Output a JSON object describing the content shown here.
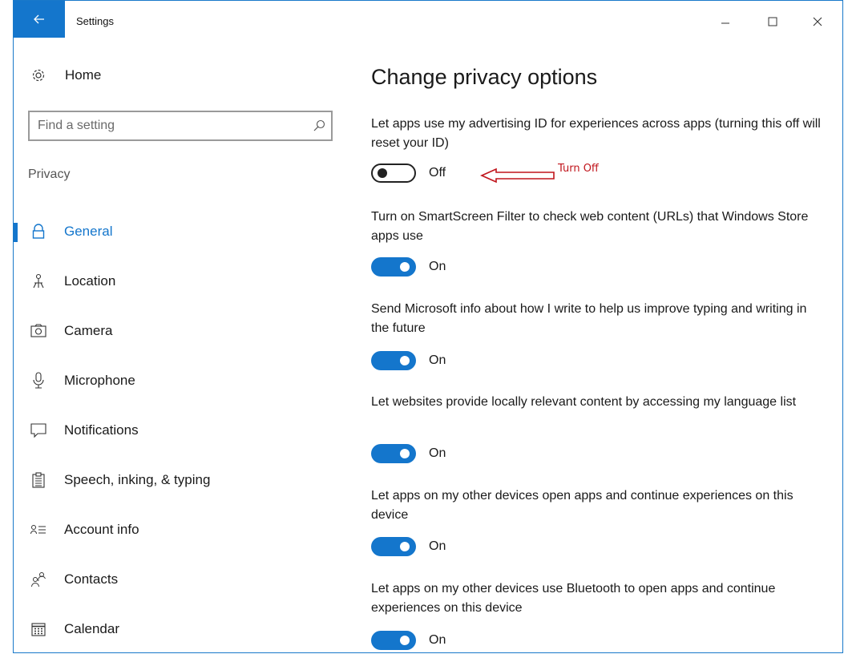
{
  "window": {
    "title": "Settings",
    "back_icon": "back-arrow-icon",
    "controls": {
      "minimize": "minimize-icon",
      "maximize": "maximize-icon",
      "close": "close-icon"
    }
  },
  "sidebar": {
    "home_label": "Home",
    "home_icon": "gear-icon",
    "search_placeholder": "Find a setting",
    "section_label": "Privacy",
    "items": [
      {
        "label": "General",
        "icon": "lock-icon",
        "active": true
      },
      {
        "label": "Location",
        "icon": "location-person-icon",
        "active": false
      },
      {
        "label": "Camera",
        "icon": "camera-icon",
        "active": false
      },
      {
        "label": "Microphone",
        "icon": "microphone-icon",
        "active": false
      },
      {
        "label": "Notifications",
        "icon": "speech-bubble-icon",
        "active": false
      },
      {
        "label": "Speech, inking, & typing",
        "icon": "clipboard-icon",
        "active": false
      },
      {
        "label": "Account info",
        "icon": "account-list-icon",
        "active": false
      },
      {
        "label": "Contacts",
        "icon": "contacts-icon",
        "active": false
      },
      {
        "label": "Calendar",
        "icon": "calendar-icon",
        "active": false
      }
    ]
  },
  "main": {
    "title": "Change privacy options",
    "settings": [
      {
        "description": "Let apps use my advertising ID for experiences across apps (turning this off will reset your ID)",
        "state": "Off",
        "on": false
      },
      {
        "description": "Turn on SmartScreen Filter to check web content (URLs) that Windows Store apps use",
        "state": "On",
        "on": true
      },
      {
        "description": "Send Microsoft info about how I write to help us improve typing and writing in the future",
        "state": "On",
        "on": true
      },
      {
        "description": "Let websites provide locally relevant content by accessing my language list",
        "state": "On",
        "on": true
      },
      {
        "description": "Let apps on my other devices open apps and continue experiences on this device",
        "state": "On",
        "on": true
      },
      {
        "description": "Let apps on my other devices use Bluetooth to open apps and continue experiences on this device",
        "state": "On",
        "on": true
      }
    ],
    "annotation": {
      "text": "Turn Off",
      "color": "#c0141b"
    }
  },
  "colors": {
    "accent": "#1476cc",
    "window_border": "#1979ca"
  }
}
